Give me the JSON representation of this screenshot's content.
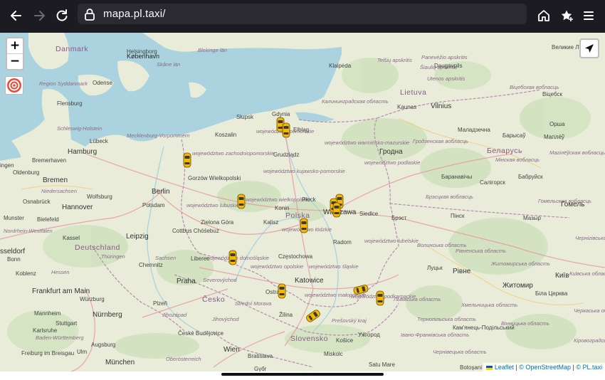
{
  "browser": {
    "url": "mapa.pl.taxi/",
    "icons": [
      "back-icon",
      "forward-icon",
      "reload-icon",
      "lock-icon",
      "home-icon",
      "bookmark-star-icon",
      "menu-icon"
    ]
  },
  "map": {
    "zoom_in": "+",
    "zoom_out": "−",
    "attribution": {
      "leaflet": "Leaflet",
      "sep1": "|",
      "osm": "© OpenStreetMap",
      "sep2": "|",
      "pltaxi": "© PL.taxi"
    },
    "labels": {
      "danmark": "Danmark",
      "helsingborg": "Helsingborg",
      "kobenhavn": "København",
      "odense": "Odense",
      "region_syddanmark": "Region Syddanmark",
      "skane": "Skåne län",
      "blekinge": "Blekinge län",
      "flensburg": "Flensburg",
      "schleswig": "Schleswig-Holstein",
      "lubeck": "Lübeck",
      "mecklenburg": "Mecklenburg-Vorpommern",
      "hamburg": "Hamburg",
      "bremerhaven": "Bremerhaven",
      "oldenburg": "Oldenburg",
      "bremen": "Bremen",
      "niedersachsen": "Niedersachsen",
      "osnabruck": "Osnabrück",
      "hannover": "Hannover",
      "wolfsburg": "Wolfsburg",
      "berlin": "Berlin",
      "potsdam": "Potsdam",
      "munster": "Munster",
      "bielefeld": "Bielefeld",
      "nordrhein": "Nordrhein-Westfalen",
      "kassel": "Kassel",
      "leipzig": "Leipzig",
      "deutschland": "Deutschland",
      "dusseldorf": "sseldorf",
      "bonn": "Bonn",
      "thuringen": "Thüringen",
      "sachsen": "Sachsen",
      "chemnitz": "Chemnitz",
      "koblenz": "Koblenz",
      "hessen": "Hessen",
      "frankfurt": "Frankfurt am Main",
      "wurzburg": "Würzburg",
      "mannheim": "Mannheim",
      "nurnberg": "Nürnberg",
      "karlsruhe": "Karlsruhe",
      "stuttgart": "Stuttgart",
      "augsburg": "Augsburg",
      "bw": "Baden-Württemberg",
      "freiburg": "Freiburg im Breisgau",
      "ulm": "Ulm",
      "munchen": "München",
      "ingen": "ingen",
      "slupsk": "Słupsk",
      "gdynia": "Gdynia",
      "elblag": "Elbląg",
      "koszalin": "Koszalin",
      "woj_pomorskie": "województwo pomorskie",
      "woj_zachodniopomorskie": "województwo zachodniopomorskie",
      "woj_warminsko": "województwo warmińsko-mazurskie",
      "woj_podlaskie": "województwo podlaskie",
      "woj_kujawsko": "województwo kujawsko-pomorskie",
      "grudziadz": "Grudziądz",
      "gorzow": "Gorzów Wielkopolski",
      "woj_lubuskie": "województwo lubuskie",
      "woj_wielkopolskie": "województwo wielkopolskie",
      "konin": "Konin",
      "plock": "Płock",
      "warszawa": "Warszawa",
      "siedlce": "Siedlce",
      "polska": "Polska",
      "kalisz": "Kalisz",
      "woj_lodzkie": "województwo łódzkie",
      "zielona": "Zielona Góra",
      "cottbus": "Cottbus Chóśebuz",
      "radom": "Radom",
      "woj_lubelskie": "województwo lubelskie",
      "woj_dolnoslaskie": "województwo dolnośląskie",
      "liberec": "Liberec",
      "czestochowa": "Częstochowa",
      "woj_opolskie": "województwo opolskie",
      "woj_slaskie": "województwo śląskie",
      "praha": "Praha",
      "severovychod": "Severovýchod",
      "katowice": "Katowice",
      "ostrava": "Ostrava",
      "woj_malopolskie": "województwo małopolskie",
      "woj_podkarpackie": "województwo podkarpackie",
      "cesko": "Česko",
      "strední_morava": "Střední Morava",
      "jihovychod": "Jihovýchod",
      "jihozapad": "Jihozápad",
      "plzen": "Plzeň",
      "ceske_budejovice": "České Budějovice",
      "zilina": "Žilina",
      "presovsky": "Prešovský kraj",
      "slovensko": "Slovensko",
      "kosice": "Košice",
      "uzhorod": "Ужгород",
      "wien": "Wien",
      "bratislava": "Bratislava",
      "oberosterreich": "Oberösterreich",
      "miskolc": "Miskolc",
      "gyor": "Győr",
      "satu_mare": "Satu Mare",
      "botosani": "Botoșani",
      "klaipeda": "Klaipėda",
      "lietuva": "Lietuva",
      "kaunas": "Kaunas",
      "vilnius": "Vilnius",
      "panevezio": "Panevėžio apskritis",
      "siauliu": "Šiaulių apskritis",
      "daugavpils": "Daugavpils",
      "utenos": "Utenos apskritis",
      "telsiu": "Telšių apskritis",
      "velikie_luki": "Великие Луки",
      "vitebsk_obl": "Віцебская вобласць",
      "vicebsk": "Віцебск",
      "kaliningrad": "Калининградская область",
      "grodno_obl": "Гродзенская вобласць",
      "hrodna": "Гродна",
      "maladzechna": "Маладзечна",
      "barysau": "Барысаў",
      "mahileu": "Магілёў",
      "mahileu_obl": "Магілёўская вобласць",
      "orsha": "Орша",
      "minsk_obl": "Мінская вобласць",
      "belarus": "Беларусь",
      "baranavichy": "Баранавічы",
      "salihorsk": "Салігорск",
      "babruisk": "Бабруйск",
      "brest_obl": "Брэсцкая вобласць",
      "gomel_obl": "Гомельская вобласць",
      "homel": "Гомель",
      "brest": "Брэст",
      "pinsk": "Пінск",
      "mazyr": "Мазыр",
      "volyn": "Волинська область",
      "rivne_obl": "Рівненська область",
      "chernihiv": "Чернігівська область",
      "lutsk": "Луцьк",
      "rivne": "Рівне",
      "zhytomyr_obl": "Житомирська область",
      "zhytomyr": "Житомир",
      "kyiv": "Київ",
      "kyiv_obl": "Київська область",
      "lviv_obl": "Львівська область",
      "bila": "Біла Церква",
      "khmelnytsk": "Хмельницька область",
      "kamianets": "Кам'янець-Подільський",
      "ternopil": "Тернопільська область",
      "vinnytsia": "Вінницька область",
      "cherkasy": "Черкаська область",
      "ivano": "Івано-Франківська область",
      "chernivtsi": "Чернівецька область",
      "kirovohrad": "Кіровоградська область"
    }
  }
}
